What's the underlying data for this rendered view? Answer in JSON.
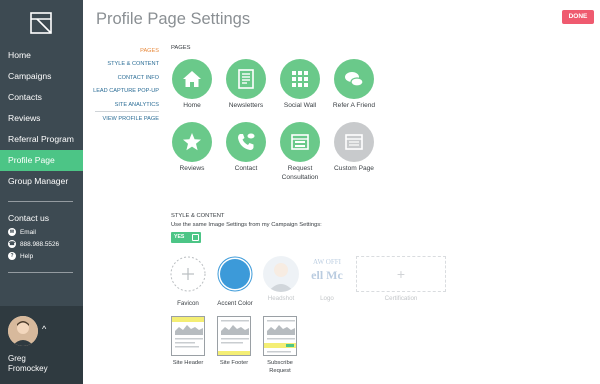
{
  "sidebar": {
    "nav": [
      "Home",
      "Campaigns",
      "Contacts",
      "Reviews",
      "Referral Program",
      "Profile Page",
      "Group Manager"
    ],
    "active_index": 5,
    "contact": {
      "title": "Contact us",
      "email": "Email",
      "phone": "888.988.5526",
      "help": "Help"
    },
    "user": {
      "first": "Greg",
      "last": "Fromockey"
    }
  },
  "header": {
    "title": "Profile Page Settings",
    "done_label": "DONE"
  },
  "subnav": {
    "items": [
      "PAGES",
      "STYLE & CONTENT",
      "CONTACT INFO",
      "LEAD CAPTURE POP-UP",
      "SITE ANALYTICS"
    ],
    "active_index": 0,
    "extra": "VIEW PROFILE PAGE"
  },
  "pages": {
    "label": "PAGES",
    "items": [
      {
        "label": "Home",
        "icon": "house-icon"
      },
      {
        "label": "Newsletters",
        "icon": "newsletter-icon"
      },
      {
        "label": "Social Wall",
        "icon": "grid-icon"
      },
      {
        "label": "Refer A Friend",
        "icon": "chat-bubbles-icon"
      },
      {
        "label": "Reviews",
        "icon": "star-icon"
      },
      {
        "label": "Contact",
        "icon": "phone-icon"
      },
      {
        "label": "Request Consultation",
        "icon": "form-icon"
      },
      {
        "label": "Custom Page",
        "icon": "custom-page-icon"
      }
    ]
  },
  "style": {
    "label": "STYLE & CONTENT",
    "description": "Use the same Image Settings from my Campaign Settings:",
    "toggle_label": "YES",
    "assets": {
      "favicon": "Favicon",
      "accent": "Accent Color",
      "headshot": "Headshot",
      "logo": "Logo",
      "logo_text_top": "AW OFFI",
      "logo_text_bottom": "ell Mc",
      "certification": "Certification"
    },
    "accent_color": "#3c9ad9",
    "templates": [
      "Site Header",
      "Site Footer",
      "Subscribe Request"
    ]
  },
  "colors": {
    "green": "#4cc586",
    "sidebar": "#3d4a52",
    "done": "#ef5a6f"
  }
}
